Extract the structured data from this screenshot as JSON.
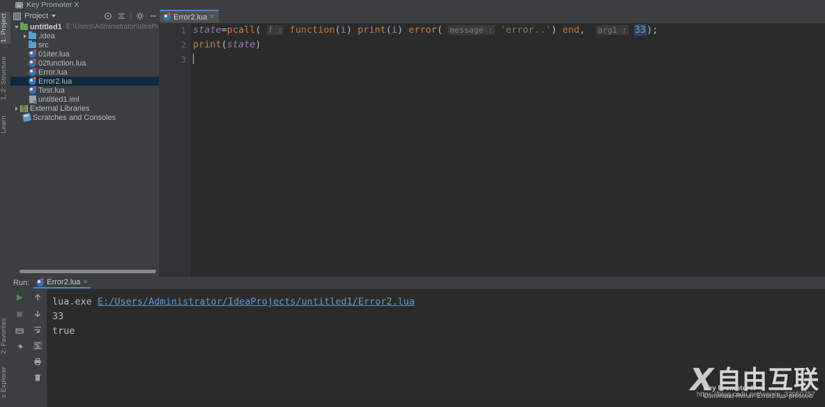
{
  "app": {
    "theme_bg": "#3c3f41",
    "editor_bg": "#2b2b2b",
    "accent": "#4a88c7",
    "selection_bg": "#0d293e"
  },
  "plugin_bar": {
    "icon": "key-promoter-icon",
    "label": "Key Promoter X"
  },
  "left_stripe": {
    "tabs": [
      {
        "label": "1: Project",
        "icon": "project-icon",
        "active": true
      },
      {
        "label": "1, 2: Structure",
        "icon": "structure-icon",
        "active": false
      },
      {
        "label": "Learn",
        "icon": "learn-icon",
        "active": false
      },
      {
        "label": "2: Favorites",
        "icon": "star-icon",
        "active": false
      },
      {
        "label": "s Explorer",
        "icon": "explorer-icon",
        "active": false
      }
    ]
  },
  "project_panel": {
    "title": "Project",
    "caret": "chevron-down-icon",
    "tools": [
      {
        "name": "locate-icon",
        "label": ""
      },
      {
        "name": "collapse-all-icon",
        "label": ""
      },
      {
        "name": "settings-gear-icon",
        "label": ""
      },
      {
        "name": "hide-icon",
        "label": ""
      }
    ],
    "tree": [
      {
        "label": "untitled1",
        "path": "E:\\Users\\Administrator\\IdeaProjects\\unt",
        "icon": "project-folder-icon",
        "indent": 0,
        "arrow": "open",
        "bold": true,
        "selected": false
      },
      {
        "label": ".idea",
        "path": "",
        "icon": "folder-icon",
        "indent": 1,
        "arrow": "closed",
        "bold": false,
        "selected": false
      },
      {
        "label": "src",
        "path": "",
        "icon": "source-folder-icon",
        "indent": 1,
        "arrow": "none",
        "bold": false,
        "selected": false
      },
      {
        "label": "01iter.lua",
        "path": "",
        "icon": "lua-file-icon",
        "indent": 1,
        "arrow": "none",
        "bold": false,
        "selected": false
      },
      {
        "label": "02function.lua",
        "path": "",
        "icon": "lua-file-icon",
        "indent": 1,
        "arrow": "none",
        "bold": false,
        "selected": false
      },
      {
        "label": "Error.lua",
        "path": "",
        "icon": "lua-file-icon",
        "indent": 1,
        "arrow": "none",
        "bold": false,
        "selected": false
      },
      {
        "label": "Error2.lua",
        "path": "",
        "icon": "lua-file-icon",
        "indent": 1,
        "arrow": "none",
        "bold": false,
        "selected": true
      },
      {
        "label": "Test.lua",
        "path": "",
        "icon": "lua-file-icon",
        "indent": 1,
        "arrow": "none",
        "bold": false,
        "selected": false
      },
      {
        "label": "untitled1.iml",
        "path": "",
        "icon": "iml-file-icon",
        "indent": 1,
        "arrow": "none",
        "bold": false,
        "selected": false
      },
      {
        "label": "External Libraries",
        "path": "",
        "icon": "libraries-icon",
        "indent": 0,
        "arrow": "closed",
        "bold": false,
        "selected": false
      },
      {
        "label": "Scratches and Consoles",
        "path": "",
        "icon": "scratches-icon",
        "indent": 0,
        "arrow": "none",
        "bold": false,
        "selected": false
      }
    ]
  },
  "editor": {
    "tab": {
      "label": "Error2.lua",
      "icon": "lua-file-icon",
      "close": "×"
    },
    "gutter_numbers": [
      "1",
      "2",
      "3"
    ],
    "code": {
      "line1": {
        "t1": "state",
        "t2": "=",
        "t3": "pcall",
        "t4": "(",
        "hint1": "f :",
        "kw": "function",
        "p1": "(",
        "arg_i": "i",
        "p2": ")",
        "fn_print": "print",
        "p3": "(",
        "arg_i2": "i",
        "p4": ")",
        "fn_error": "error",
        "p5": "(",
        "hint2": "message :",
        "str": "'error..'",
        "p6": ")",
        "kw_end": "end",
        "comma": ",",
        "hint3": "arg1 :",
        "num": "33",
        "p7": ")",
        "semi": ";"
      },
      "line2": {
        "fn": "print",
        "p1": "(",
        "var": "state",
        "p2": ")"
      },
      "line3": {
        "text": ""
      }
    }
  },
  "run_panel": {
    "label": "Run:",
    "tab": {
      "label": "Error2.lua",
      "icon": "lua-file-icon",
      "close": "×"
    },
    "toolbar_left": [
      {
        "name": "rerun-icon"
      },
      {
        "name": "stop-icon"
      },
      {
        "name": "layout-icon"
      },
      {
        "name": "pin-icon"
      }
    ],
    "toolbar_right": [
      {
        "name": "arrow-up-icon"
      },
      {
        "name": "arrow-down-icon"
      },
      {
        "name": "soft-wrap-icon"
      },
      {
        "name": "scroll-to-end-icon",
        "selected": true
      },
      {
        "name": "print-icon"
      },
      {
        "name": "trash-icon"
      }
    ],
    "console_lines": [
      {
        "prefix": "lua.exe ",
        "link": "E:/Users/Administrator/IdeaProjects/untitled1/Error2.lua"
      },
      {
        "prefix": "33",
        "link": ""
      },
      {
        "prefix": "true",
        "link": ""
      }
    ]
  },
  "watermark": {
    "logo_x": "X",
    "logo_cn": "自由互联",
    "url": "https://blog.csdn.net/weixin_33950757"
  },
  "toast": {
    "title": "Key Promoter X",
    "subtitle": "Command Rerun 'Error2.lua' pressed"
  }
}
